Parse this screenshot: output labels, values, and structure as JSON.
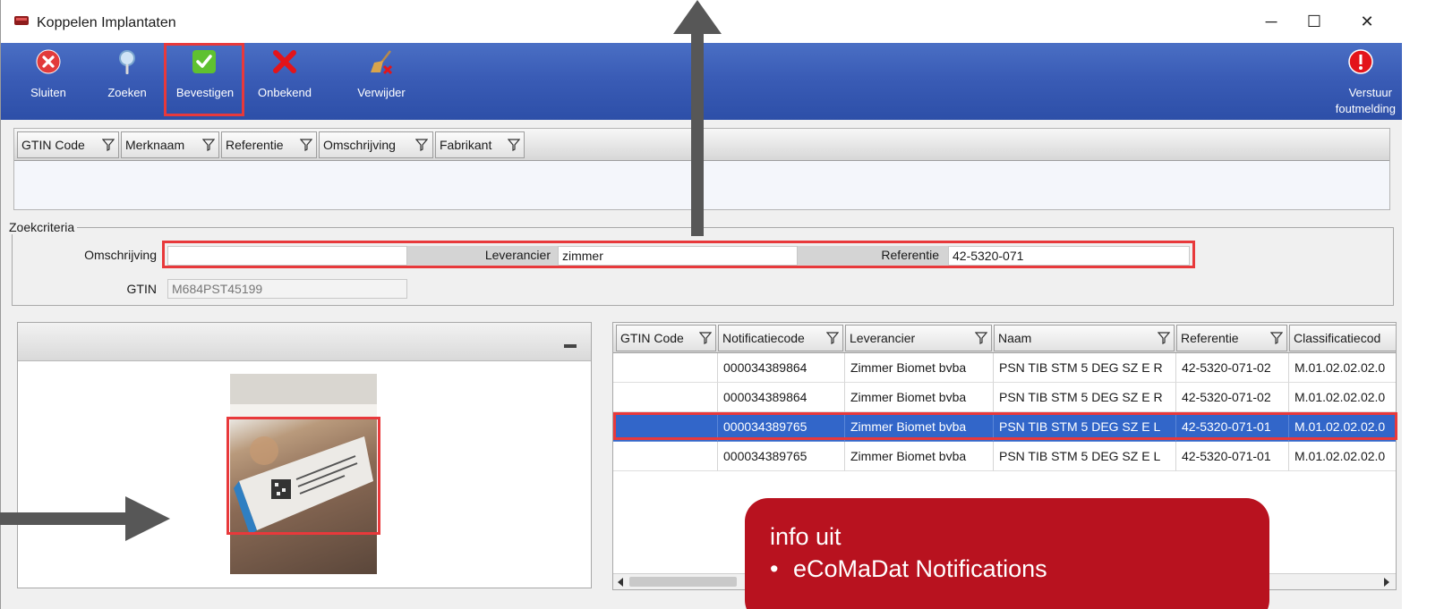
{
  "window": {
    "title": "Koppelen Implantaten",
    "minimize": "─",
    "maximize": "☐",
    "close": "✕"
  },
  "toolbar": {
    "sluiten": "Sluiten",
    "zoeken": "Zoeken",
    "bevestigen": "Bevestigen",
    "onbekend": "Onbekend",
    "verwijder": "Verwijder",
    "verstuur_line1": "Verstuur",
    "verstuur_line2": "foutmelding"
  },
  "top_grid": {
    "columns": [
      "GTIN Code",
      "Merknaam",
      "Referentie",
      "Omschrijving",
      "Fabrikant"
    ]
  },
  "zoekcriteria": {
    "title": "Zoekcriteria",
    "omschrijving_label": "Omschrijving",
    "omschrijving_value": "",
    "leverancier_label": "Leverancier",
    "leverancier_value": "zimmer",
    "referentie_label": "Referentie",
    "referentie_value": "42-5320-071",
    "gtin_label": "GTIN",
    "gtin_value": "M684PST45199"
  },
  "results_grid": {
    "columns": [
      "GTIN Code",
      "Notificatiecode",
      "Leverancier",
      "Naam",
      "Referentie",
      "Classificatiecod"
    ],
    "rows": [
      [
        "",
        "000034389864",
        "Zimmer Biomet bvba",
        "PSN TIB STM 5 DEG SZ E R",
        "42-5320-071-02",
        "M.01.02.02.02.0"
      ],
      [
        "",
        "000034389864",
        "Zimmer Biomet bvba",
        "PSN TIB STM 5 DEG SZ E R",
        "42-5320-071-02",
        "M.01.02.02.02.0"
      ],
      [
        "",
        "000034389765",
        "Zimmer Biomet bvba",
        "PSN TIB STM 5 DEG SZ E L",
        "42-5320-071-01",
        "M.01.02.02.02.0"
      ],
      [
        "",
        "000034389765",
        "Zimmer Biomet bvba",
        "PSN TIB STM 5 DEG SZ E L",
        "42-5320-071-01",
        "M.01.02.02.02.0"
      ]
    ]
  },
  "info": {
    "heading": "info uit",
    "bullet": "•",
    "item": "eCoMaDat Notifications"
  },
  "colors": {
    "accent_red": "#e8393b",
    "ribbon_blue": "#3a5cb6",
    "selection_blue": "#3266c9",
    "info_red": "#b8121f"
  }
}
